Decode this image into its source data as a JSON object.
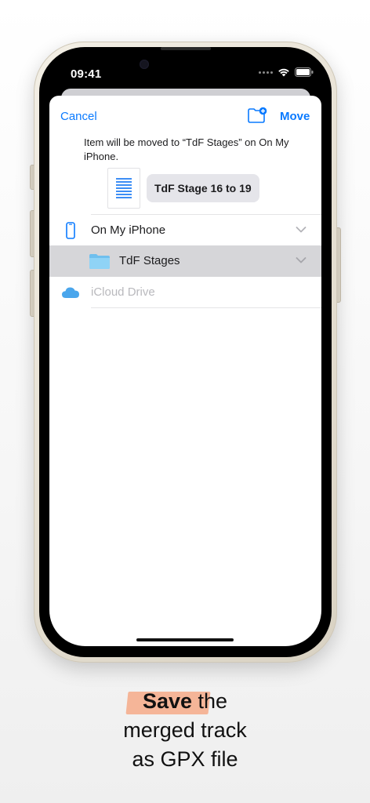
{
  "status_bar": {
    "time": "09:41"
  },
  "nav": {
    "cancel_label": "Cancel",
    "move_label": "Move",
    "new_folder_icon": "folder-plus-icon"
  },
  "message": "Item will be moved to “TdF Stages” on On My iPhone.",
  "file": {
    "name": "TdF Stage 16 to 19",
    "icon": "document-icon"
  },
  "locations": [
    {
      "label": "On My iPhone",
      "icon": "iphone-icon",
      "state": "normal"
    },
    {
      "label": "TdF Stages",
      "icon": "folder-icon",
      "state": "selected"
    },
    {
      "label": "iCloud Drive",
      "icon": "cloud-icon",
      "state": "disabled"
    }
  ],
  "caption": {
    "highlight": "Save",
    "line1_rest": " the",
    "line2": "merged track",
    "line3": "as GPX file"
  },
  "colors": {
    "accent": "#0a7aff",
    "highlight": "#f6a07a",
    "selected_row": "#d6d6d9",
    "folder": "#7ec8f2"
  }
}
